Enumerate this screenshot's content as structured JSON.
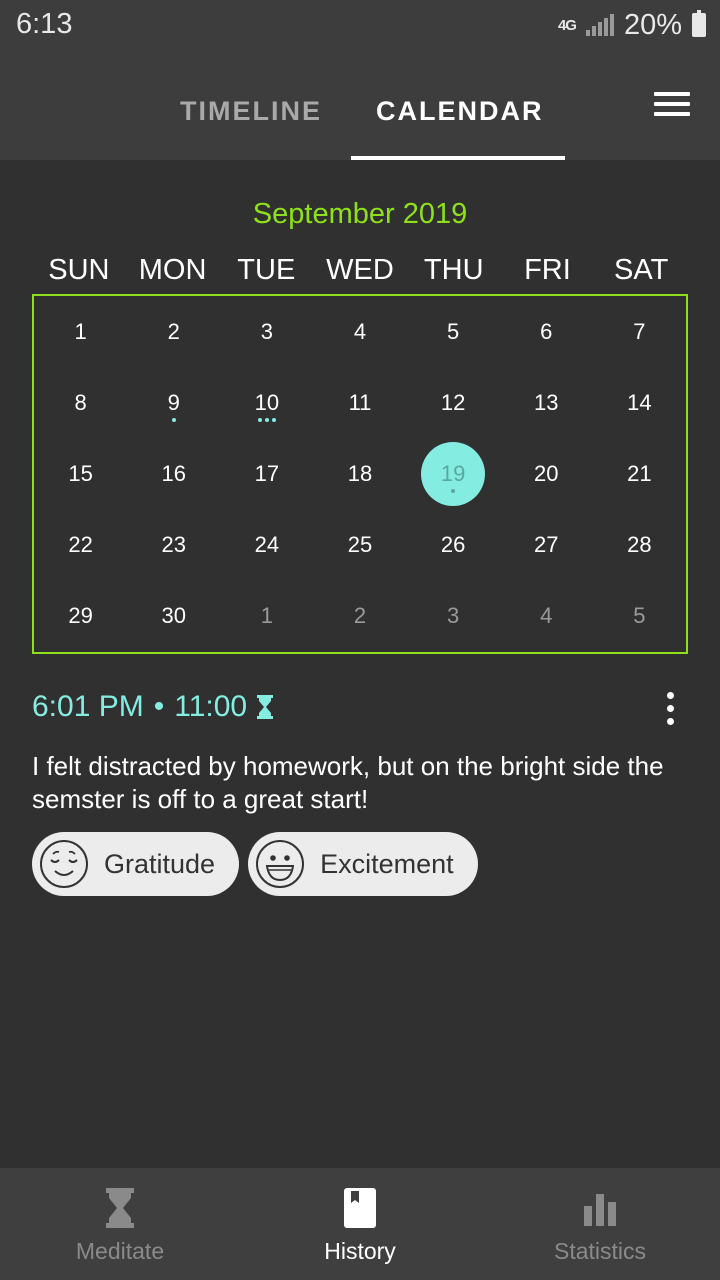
{
  "status_bar": {
    "time": "6:13",
    "network": "4G",
    "battery": "20%"
  },
  "tabs": {
    "timeline": "TIMELINE",
    "calendar": "CALENDAR",
    "active": "CALENDAR"
  },
  "calendar": {
    "month": "September 2019",
    "weekdays": [
      "SUN",
      "MON",
      "TUE",
      "WED",
      "THU",
      "FRI",
      "SAT"
    ],
    "days": [
      {
        "n": "1",
        "other": false,
        "dots": 0
      },
      {
        "n": "2",
        "other": false,
        "dots": 0
      },
      {
        "n": "3",
        "other": false,
        "dots": 0
      },
      {
        "n": "4",
        "other": false,
        "dots": 0
      },
      {
        "n": "5",
        "other": false,
        "dots": 0
      },
      {
        "n": "6",
        "other": false,
        "dots": 0
      },
      {
        "n": "7",
        "other": false,
        "dots": 0
      },
      {
        "n": "8",
        "other": false,
        "dots": 0
      },
      {
        "n": "9",
        "other": false,
        "dots": 1
      },
      {
        "n": "10",
        "other": false,
        "dots": 3
      },
      {
        "n": "11",
        "other": false,
        "dots": 0
      },
      {
        "n": "12",
        "other": false,
        "dots": 0
      },
      {
        "n": "13",
        "other": false,
        "dots": 0
      },
      {
        "n": "14",
        "other": false,
        "dots": 0
      },
      {
        "n": "15",
        "other": false,
        "dots": 0
      },
      {
        "n": "16",
        "other": false,
        "dots": 0
      },
      {
        "n": "17",
        "other": false,
        "dots": 0
      },
      {
        "n": "18",
        "other": false,
        "dots": 0
      },
      {
        "n": "19",
        "other": false,
        "dots": 1,
        "selected": true
      },
      {
        "n": "20",
        "other": false,
        "dots": 0
      },
      {
        "n": "21",
        "other": false,
        "dots": 0
      },
      {
        "n": "22",
        "other": false,
        "dots": 0
      },
      {
        "n": "23",
        "other": false,
        "dots": 0
      },
      {
        "n": "24",
        "other": false,
        "dots": 0
      },
      {
        "n": "25",
        "other": false,
        "dots": 0
      },
      {
        "n": "26",
        "other": false,
        "dots": 0
      },
      {
        "n": "27",
        "other": false,
        "dots": 0
      },
      {
        "n": "28",
        "other": false,
        "dots": 0
      },
      {
        "n": "29",
        "other": false,
        "dots": 0
      },
      {
        "n": "30",
        "other": false,
        "dots": 0
      },
      {
        "n": "1",
        "other": true,
        "dots": 0
      },
      {
        "n": "2",
        "other": true,
        "dots": 0
      },
      {
        "n": "3",
        "other": true,
        "dots": 0
      },
      {
        "n": "4",
        "other": true,
        "dots": 0
      },
      {
        "n": "5",
        "other": true,
        "dots": 0
      }
    ]
  },
  "entry": {
    "time": "6:01 PM",
    "separator": "•",
    "duration": "11:00",
    "duration_icon": "hourglass-icon",
    "text": "I felt distracted by homework, but on the bright side the semster is off to a great start!",
    "emotions": [
      {
        "label": "Gratitude",
        "icon": "content-face-icon"
      },
      {
        "label": "Excitement",
        "icon": "grinning-face-icon"
      }
    ]
  },
  "bottom_nav": {
    "items": [
      {
        "label": "Meditate",
        "icon": "hourglass-icon",
        "active": false
      },
      {
        "label": "History",
        "icon": "journal-icon",
        "active": true
      },
      {
        "label": "Statistics",
        "icon": "bar-chart-icon",
        "active": false
      }
    ]
  },
  "colors": {
    "accent_green": "#8ee01a",
    "accent_teal": "#84ece0",
    "background": "#303030",
    "header": "#3d3d3d"
  }
}
